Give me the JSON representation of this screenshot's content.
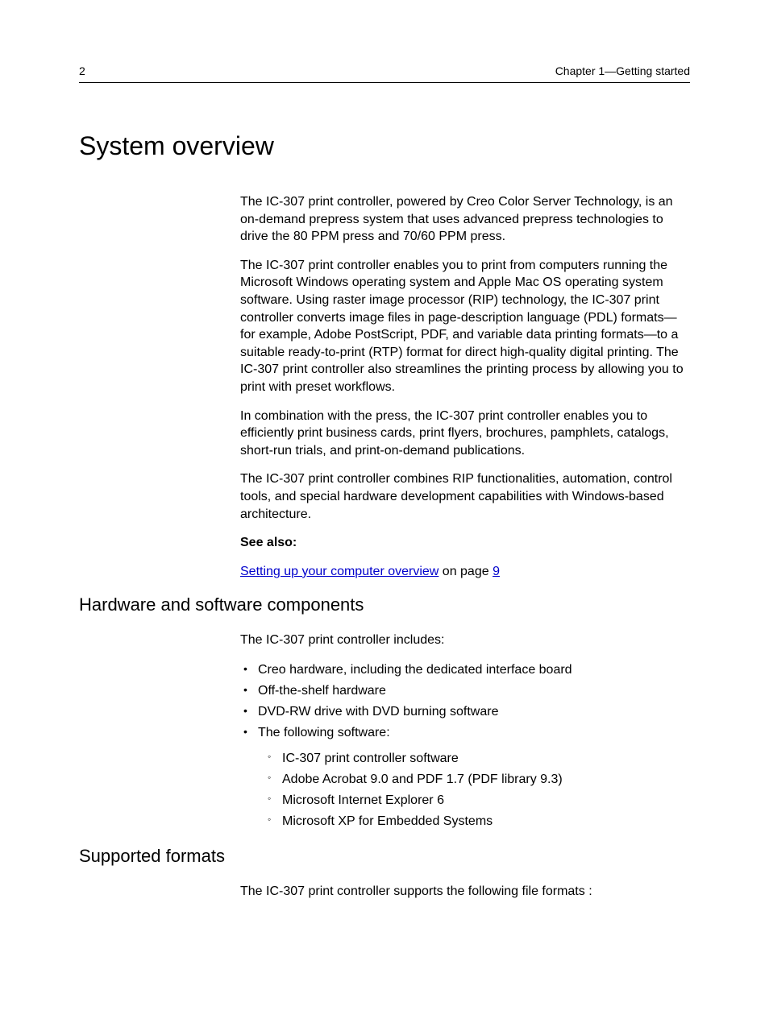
{
  "header": {
    "page_number": "2",
    "chapter": "Chapter 1—Getting started"
  },
  "h1": "System overview",
  "intro": {
    "p1": "The IC-307 print controller, powered by Creo Color Server Technology, is an on-demand prepress system that uses advanced prepress technologies to drive the 80 PPM press and 70/60 PPM press.",
    "p2": "The IC-307 print controller enables you to print from computers running the Microsoft Windows operating system and Apple Mac OS operating system software. Using raster image processor (RIP) technology, the IC-307 print controller converts image files in page-description language (PDL) formats—for example, Adobe PostScript, PDF, and variable data printing formats—to a suitable ready-to-print (RTP) format for direct high-quality digital printing. The IC-307 print controller also streamlines the printing process by allowing you to print with preset workflows.",
    "p3": "In combination with the press, the IC-307 print controller enables you to efficiently print business cards, print flyers, brochures, pamphlets, catalogs, short-run trials, and print-on-demand publications.",
    "p4": "The IC-307 print controller combines RIP functionalities, automation, control tools, and special hardware development capabilities with Windows-based architecture."
  },
  "see_also": {
    "label": "See also:",
    "link_text": "Setting up your computer overview",
    "middle": " on page ",
    "page_link": "9"
  },
  "hw_section": {
    "title": "Hardware and software components",
    "lead": "The IC-307 print controller includes:",
    "items": [
      "Creo hardware, including the dedicated interface board",
      "Off-the-shelf hardware",
      "DVD-RW drive with DVD burning software",
      "The following software:"
    ],
    "sub_items": [
      "IC-307 print controller software",
      "Adobe Acrobat 9.0 and PDF 1.7 (PDF library 9.3)",
      "Microsoft Internet Explorer 6",
      "Microsoft XP for Embedded Systems"
    ]
  },
  "formats_section": {
    "title": "Supported formats",
    "lead": "The IC-307 print controller supports the following file formats :"
  }
}
